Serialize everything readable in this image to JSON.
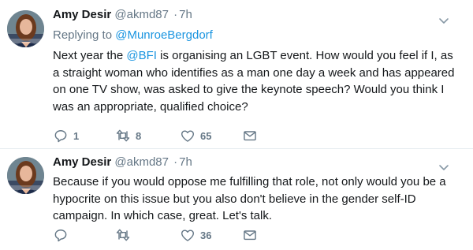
{
  "tweets": [
    {
      "author_name": "Amy Desir",
      "handle": "@akmd87",
      "separator": "·",
      "time": "7h",
      "reply_prefix": "Replying to",
      "reply_to": "@MunroeBergdorf",
      "text_before_link": "Next year the",
      "text_link": "@BFI",
      "text_after_link": "is organising an LGBT event. How would you feel if I, as a straight woman who identifies as a man one day a week and has appeared on one TV show, was asked to give the keynote speech? Would you think I was an appropriate, qualified choice?",
      "reply_count": "1",
      "retweet_count": "8",
      "like_count": "65"
    },
    {
      "author_name": "Amy Desir",
      "handle": "@akmd87",
      "separator": "·",
      "time": "7h",
      "text": "Because if you would oppose me fulfilling that role, not only would you be a hypocrite on this issue but you also don't believe in the gender self-ID campaign. In which case, great. Let's talk.",
      "reply_count": "",
      "retweet_count": "",
      "like_count": "36"
    }
  ],
  "colors": {
    "link": "#1b95e0",
    "secondary_text": "#657786",
    "icon": "#657786",
    "divider": "#e6ecf0"
  },
  "icons": [
    "reply-icon",
    "retweet-icon",
    "like-icon",
    "direct-message-icon",
    "chevron-down-icon"
  ]
}
